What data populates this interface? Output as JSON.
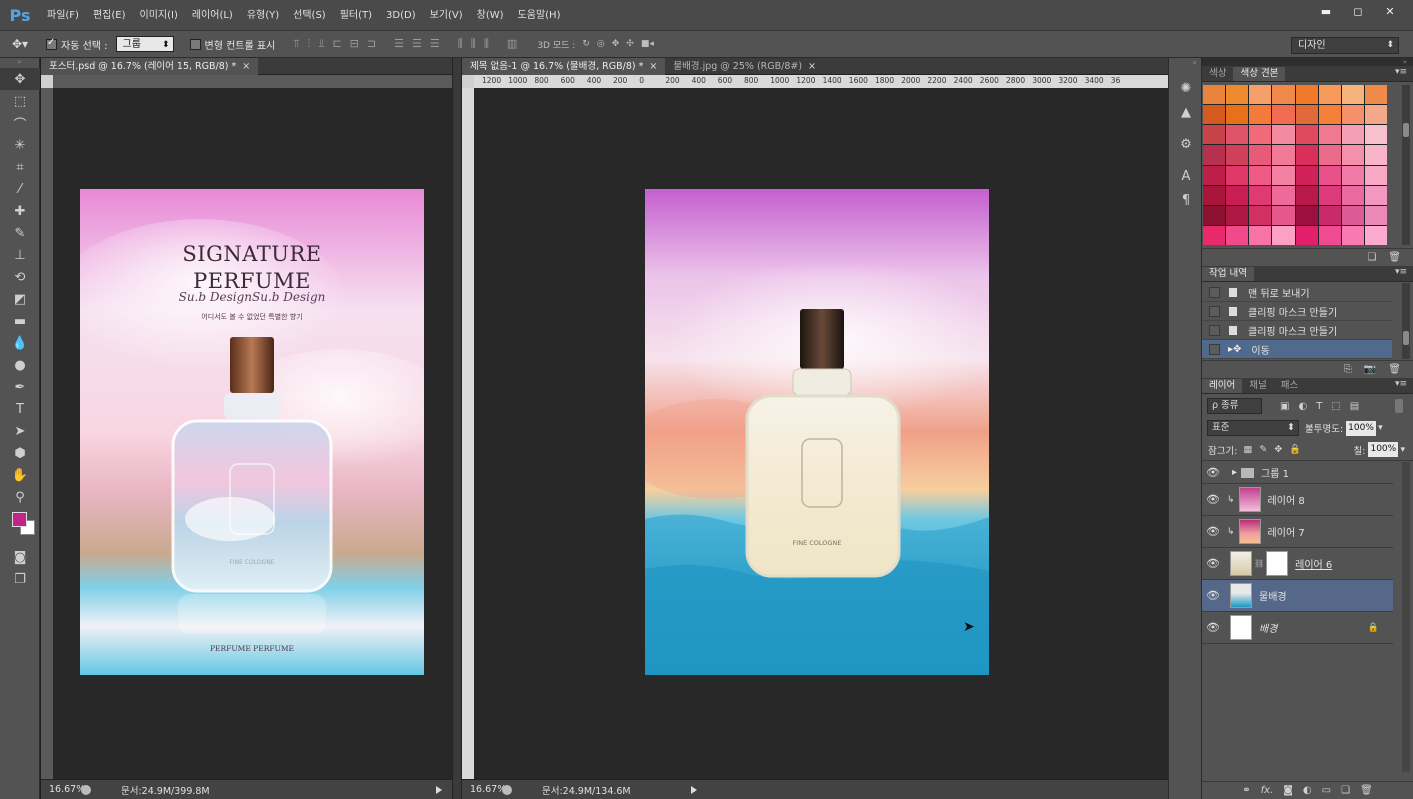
{
  "app": {
    "logo": "Ps",
    "menu": [
      "파일(F)",
      "편집(E)",
      "이미지(I)",
      "레이어(L)",
      "유형(Y)",
      "선택(S)",
      "필터(T)",
      "3D(D)",
      "보기(V)",
      "창(W)",
      "도움말(H)"
    ],
    "window_controls": [
      "▬",
      "◻",
      "✕"
    ]
  },
  "options": {
    "tool_icon": "move-tool-icon",
    "auto_select_label": "자동 선택 :",
    "auto_select_value": "그룹",
    "transform_label": "변형 컨트롤 표시",
    "mode3d_label": "3D 모드 :",
    "workspace": "디자인"
  },
  "documents": {
    "left": {
      "tab": "포스터.psd @ 16.7% (레이어 15, RGB/8) *",
      "zoom": "16.67%",
      "doc_size": "문서:24.9M/399.8M",
      "poster": {
        "title_line1": "SIGNATURE",
        "title_line2": "PERFUME",
        "script": "Su.b DesignSu.b Design",
        "tagline": "어디서도 볼 수 없었던 특별한 향기",
        "bottle_label": "FINE COLOGNE",
        "bottom": "PERFUME PERFUME"
      }
    },
    "right": {
      "tabs": [
        "제목 없음-1 @ 16.7% (물배경, RGB/8) *",
        "물배경.jpg @ 25% (RGB/8#)"
      ],
      "zoom": "16.67%",
      "doc_size": "문서:24.9M/134.6M",
      "ruler_labels": [
        "1200",
        "1000",
        "800",
        "600",
        "400",
        "200",
        "0",
        "200",
        "400",
        "600",
        "800",
        "1000",
        "1200",
        "1400",
        "1600",
        "1800",
        "2000",
        "2200",
        "2400",
        "2600",
        "2800",
        "3000",
        "3200",
        "3400",
        "36"
      ],
      "bottle_label": "FINE COLOGNE"
    }
  },
  "panels": {
    "color_tabs": [
      "색상",
      "색상 견본"
    ],
    "swatch_colors": [
      "#e8843c",
      "#f08a2e",
      "#f5a06a",
      "#ef8a4a",
      "#f07a2a",
      "#f59a5a",
      "#f4b47c",
      "#f08a4a",
      "#d45a20",
      "#e8701a",
      "#f47a3a",
      "#f26a50",
      "#e06a3a",
      "#f4803a",
      "#f4906a",
      "#f4a88a",
      "#c8424a",
      "#e0546a",
      "#f06a7a",
      "#f48aa0",
      "#e04a60",
      "#f07890",
      "#f4a0b4",
      "#f8c0cc",
      "#b83050",
      "#d0405a",
      "#e85a7a",
      "#f07a98",
      "#d8305a",
      "#ec6a8c",
      "#f490ac",
      "#f8b4c8",
      "#c01e4a",
      "#e03868",
      "#f05a86",
      "#f480a4",
      "#d02258",
      "#e8508a",
      "#f27aa8",
      "#f6a8c4",
      "#a8163c",
      "#c81e54",
      "#e03a72",
      "#ee6a98",
      "#b8184a",
      "#dc3a7a",
      "#ea6aa0",
      "#f298c0",
      "#8c1030",
      "#b01844",
      "#d03064",
      "#e4588c",
      "#9c1040",
      "#c82a6a",
      "#dc5a96",
      "#ec88b8",
      "#e82a6c",
      "#f04a8a",
      "#f874a8",
      "#fca0c4",
      "#e0206a",
      "#f04a92",
      "#f87ab0",
      "#fcaad0"
    ],
    "history_tab": "작업 내역",
    "history": [
      {
        "label": "맨 뒤로 보내기",
        "active": false
      },
      {
        "label": "클리핑 마스크 만들기",
        "active": false
      },
      {
        "label": "클리핑 마스크 만들기",
        "active": false
      },
      {
        "label": "이동",
        "active": true
      }
    ],
    "layer_tabs": [
      "레이어",
      "채널",
      "패스"
    ],
    "filter_label": "ρ 종류",
    "blend_mode": "표준",
    "opacity_label": "불투명도:",
    "opacity_value": "100%",
    "lock_label": "잠그기:",
    "fill_label": "칠:",
    "fill_value": "100%",
    "layers": [
      {
        "name": "그룹 1",
        "type": "group"
      },
      {
        "name": "레이어 8",
        "type": "clip"
      },
      {
        "name": "레이어 7",
        "type": "clip"
      },
      {
        "name": "레이어 6",
        "type": "masked"
      },
      {
        "name": "물배경",
        "type": "selected"
      },
      {
        "name": "배경",
        "type": "locked"
      }
    ],
    "footer_icons": [
      "link-icon",
      "fx-icon",
      "mask-icon",
      "adjustment-icon",
      "folder-icon",
      "new-layer-icon",
      "trash-icon"
    ]
  }
}
